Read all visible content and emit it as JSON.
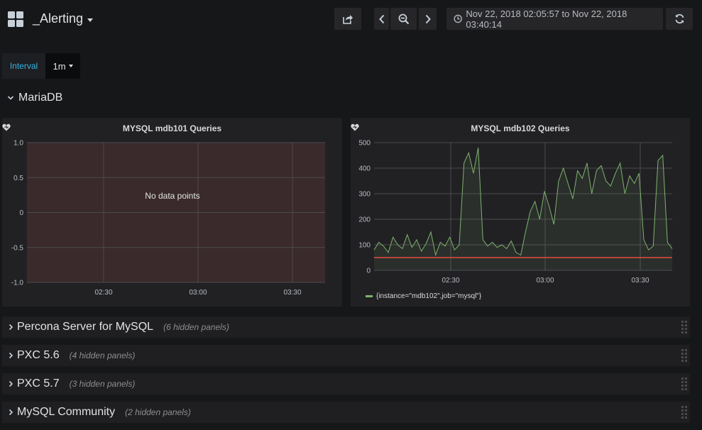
{
  "header": {
    "title": "_Alerting",
    "time_range": "Nov 22, 2018 02:05:57 to Nov 22, 2018 03:40:14",
    "icons": [
      "dashboard-grid-icon",
      "share-icon",
      "chevron-left-icon",
      "zoom-out-icon",
      "chevron-right-icon",
      "clock-icon",
      "refresh-icon"
    ]
  },
  "variables": {
    "interval_label": "Interval",
    "interval_value": "1m"
  },
  "row": {
    "title": "MariaDB"
  },
  "panels": [
    {
      "title": "MYSQL mdb101 Queries",
      "message": "No data points",
      "y_ticks": [
        "1.0",
        "0.5",
        "0",
        "-0.5",
        "-1.0"
      ],
      "x_ticks": [
        "02:30",
        "03:00",
        "03:30"
      ],
      "alert_state": "alerting",
      "colors": {
        "alert_fill": "#3a2a2b"
      }
    },
    {
      "title": "MYSQL mdb102 Queries",
      "y_ticks": [
        "500",
        "400",
        "300",
        "200",
        "100",
        "0"
      ],
      "x_ticks": [
        "02:30",
        "03:00",
        "03:30"
      ],
      "legend": "{instance=\"mdb102\",job=\"mysql\"}",
      "colors": {
        "series": "#7eb26d",
        "threshold": "#e24d42"
      }
    }
  ],
  "chart_data": {
    "type": "line",
    "title": "MYSQL mdb102 Queries",
    "xlabel": "",
    "ylabel": "",
    "ylim": [
      0,
      500
    ],
    "threshold": 50,
    "x_ticks": [
      "02:30",
      "03:00",
      "03:30"
    ],
    "series": [
      {
        "name": "{instance=\"mdb102\",job=\"mysql\"}",
        "color": "#7eb26d",
        "x": [
          0,
          1.5,
          3,
          4.5,
          6,
          7.5,
          9,
          10.5,
          12,
          13.5,
          15,
          16.5,
          18,
          19.5,
          21,
          22.5,
          24,
          25.5,
          27,
          28.5,
          30,
          31.5,
          33,
          34.5,
          36,
          37.5,
          39,
          40.5,
          42,
          43.5,
          45,
          46.5,
          48,
          49.5,
          51,
          52.5,
          54,
          55.5,
          57,
          58.5,
          60,
          61.5,
          63,
          64.5,
          66,
          67.5,
          69,
          70.5,
          72,
          73.5,
          75,
          76.5,
          78,
          79.5,
          81,
          82.5,
          84,
          85.5,
          87,
          88.5,
          90,
          91.5,
          93,
          94.5
        ],
        "values": [
          80,
          110,
          95,
          70,
          130,
          100,
          85,
          140,
          90,
          120,
          75,
          105,
          150,
          60,
          110,
          95,
          130,
          80,
          100,
          420,
          460,
          380,
          480,
          120,
          95,
          110,
          90,
          100,
          85,
          115,
          70,
          60,
          150,
          230,
          270,
          200,
          310,
          250,
          180,
          350,
          400,
          340,
          280,
          390,
          360,
          420,
          300,
          390,
          410,
          350,
          330,
          380,
          420,
          300,
          370,
          340,
          380,
          120,
          80,
          95,
          430,
          450,
          110,
          85
        ]
      }
    ]
  },
  "collapsed_rows": [
    {
      "title": "Percona Server for MySQL",
      "hidden": "(6 hidden panels)"
    },
    {
      "title": "PXC 5.6",
      "hidden": "(4 hidden panels)"
    },
    {
      "title": "PXC 5.7",
      "hidden": "(3 hidden panels)"
    },
    {
      "title": "MySQL Community",
      "hidden": "(2 hidden panels)"
    }
  ]
}
